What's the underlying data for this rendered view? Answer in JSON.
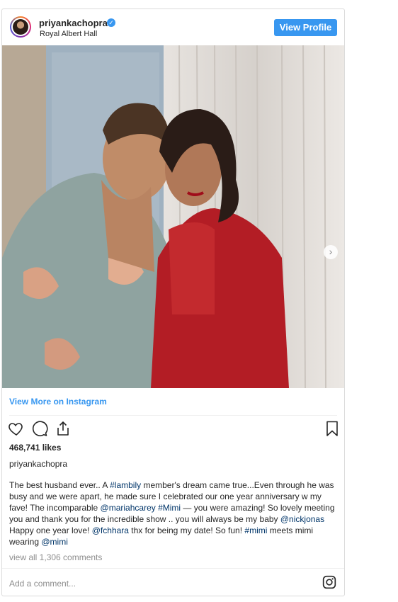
{
  "header": {
    "username": "priyankachopra",
    "location": "Royal Albert Hall",
    "view_profile_label": "View Profile"
  },
  "post": {
    "view_more_label": "View More on Instagram",
    "likes": "468,741 likes",
    "owner": "priyankachopra",
    "caption_segments": [
      {
        "text": "The best husband ever.. A ",
        "type": "text"
      },
      {
        "text": "#lambily",
        "type": "tag"
      },
      {
        "text": " member's dream came true...Even through he was busy and we were apart, he made sure I celebrated our one year anniversary w my fave! The incomparable ",
        "type": "text"
      },
      {
        "text": "@mariahcarey",
        "type": "tag"
      },
      {
        "text": " ",
        "type": "text"
      },
      {
        "text": "#Mimi",
        "type": "tag"
      },
      {
        "text": " — you were amazing! So lovely meeting you and thank you for the incredible show .. you will always be my baby ",
        "type": "text"
      },
      {
        "text": "@nickjonas",
        "type": "tag"
      },
      {
        "text": " Happy one year love! ",
        "type": "text"
      },
      {
        "text": "@fchhara",
        "type": "tag"
      },
      {
        "text": " thx for being my date! So fun! ",
        "type": "text"
      },
      {
        "text": "#mimi",
        "type": "tag"
      },
      {
        "text": " meets mimi wearing ",
        "type": "text"
      },
      {
        "text": "@mimi",
        "type": "tag"
      }
    ],
    "comments_link": "view all 1,306 comments",
    "add_comment_placeholder": "Add a comment..."
  },
  "icons": {
    "like": "heart-icon",
    "comment": "comment-icon",
    "share": "share-icon",
    "save": "bookmark-icon",
    "instagram": "instagram-icon",
    "next": "chevron-right-icon",
    "verified": "verified-badge-icon"
  },
  "colors": {
    "accent": "#3897f0",
    "tag": "#003569",
    "muted": "#8e8e8e"
  }
}
